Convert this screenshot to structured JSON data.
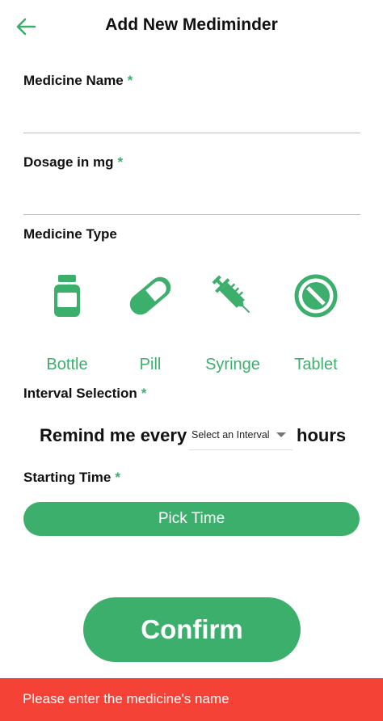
{
  "colors": {
    "accent": "#3daf6c",
    "error": "#f44336",
    "divider": "#bdbdbd"
  },
  "header": {
    "back_icon": "arrow-left-icon",
    "title": "Add New Mediminder"
  },
  "form": {
    "medicine_name": {
      "label": "Medicine Name",
      "required": "*",
      "value": ""
    },
    "dosage": {
      "label": "Dosage in mg",
      "required": "*",
      "value": ""
    },
    "medicine_type": {
      "label": "Medicine Type",
      "options": [
        {
          "label": "Bottle",
          "icon": "bottle-icon"
        },
        {
          "label": "Pill",
          "icon": "pill-icon"
        },
        {
          "label": "Syringe",
          "icon": "syringe-icon"
        },
        {
          "label": "Tablet",
          "icon": "tablet-icon"
        }
      ]
    },
    "interval": {
      "label": "Interval Selection",
      "required": "*",
      "prefix": "Remind me every",
      "select_placeholder": "Select an Interval",
      "suffix": "hours"
    },
    "starting_time": {
      "label": "Starting Time",
      "required": "*",
      "button": "Pick Time"
    }
  },
  "confirm_label": "Confirm",
  "snackbar": {
    "message": "Please enter the medicine's name"
  }
}
